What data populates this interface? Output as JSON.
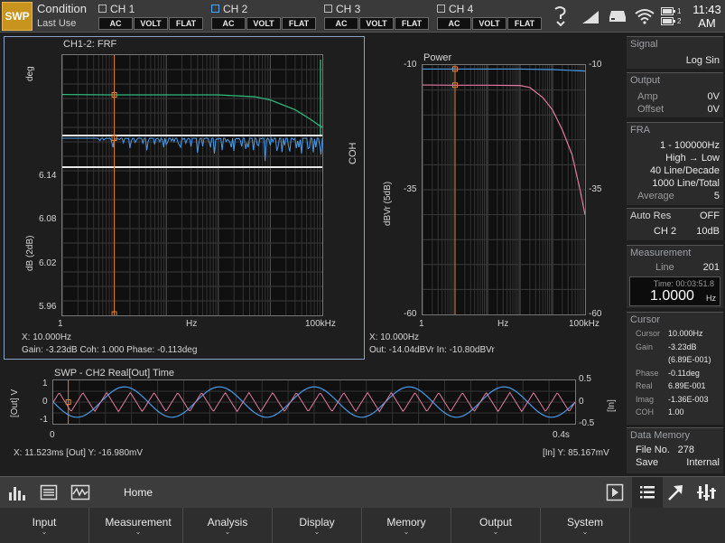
{
  "header": {
    "mode": "SWP",
    "condition_title": "Condition",
    "condition_value": "Last Use",
    "channels": [
      {
        "name": "CH 1",
        "buttons": [
          "AC",
          "VOLT",
          "FLAT"
        ],
        "selected": false
      },
      {
        "name": "CH 2",
        "buttons": [
          "AC",
          "VOLT",
          "FLAT"
        ],
        "selected": true
      },
      {
        "name": "CH 3",
        "buttons": [
          "AC",
          "VOLT",
          "FLAT"
        ],
        "selected": false
      },
      {
        "name": "CH 4",
        "buttons": [
          "AC",
          "VOLT",
          "FLAT"
        ],
        "selected": false
      }
    ],
    "battery_labels": [
      "1",
      "2"
    ],
    "time": "11:43",
    "ampm": "AM"
  },
  "frf": {
    "title": "CH1-2: FRF",
    "upper_ylabel": "deg",
    "lower_ylabel": "dB (2dB)",
    "right_label": "COH",
    "y_ticks": [
      "6.14",
      "6.08",
      "6.02",
      "5.96"
    ],
    "x_ticks": [
      "1",
      "Hz",
      "100kHz"
    ],
    "readout_x": "X: 10.000Hz",
    "readout_vals": "Gain: -3.23dB Coh: 1.000 Phase: -0.113deg"
  },
  "power": {
    "title": "Power",
    "ylabel": "dBVr (5dB)",
    "y_ticks_left": [
      "-10",
      "-35",
      "-60"
    ],
    "y_ticks_right": [
      "-10",
      "-35",
      "-60"
    ],
    "x_ticks": [
      "1",
      "Hz",
      "100kHz"
    ],
    "readout_x": "X: 10.000Hz",
    "readout_vals": "Out: -14.04dBVr In: -10.80dBVr"
  },
  "time_plot": {
    "title": "SWP - CH2 Real[Out] Time",
    "left_label": "[Out] V",
    "right_label": "[In]",
    "left_ticks": [
      "1",
      "0",
      "-1"
    ],
    "right_ticks": [
      "0.5",
      "0",
      "-0.5"
    ],
    "x_ticks": [
      "0",
      "0.4s"
    ],
    "readout_left": "X: 11.523ms [Out] Y: -16.980mV",
    "readout_right": "[In] Y: 85.167mV"
  },
  "chart_data": [
    {
      "type": "line",
      "title": "CH1-2: FRF",
      "xscale": "log",
      "xlim": [
        1,
        100000
      ],
      "ylim": [
        5.96,
        6.14
      ],
      "ylabel": "dB (2dB)",
      "cursor_x": 10,
      "series": [
        {
          "name": "Gain",
          "x": [
            1,
            10,
            100,
            1000,
            5000,
            10000,
            30000,
            60000,
            90000,
            100000
          ],
          "values": [
            -3.2,
            -3.23,
            -3.23,
            -3.23,
            -3.4,
            -3.7,
            -4.6,
            -5.5,
            -6.1,
            -6.2
          ]
        },
        {
          "name": "COH",
          "x": [
            1,
            10,
            100,
            1000,
            10000,
            100000
          ],
          "values": [
            1.0,
            1.0,
            1.0,
            1.0,
            1.0,
            1.0
          ]
        }
      ]
    },
    {
      "type": "line",
      "title": "Power",
      "xscale": "log",
      "xlim": [
        1,
        100000
      ],
      "ylim": [
        -60,
        -10
      ],
      "ylabel": "dBVr (5dB)",
      "cursor_x": 10,
      "series": [
        {
          "name": "In",
          "x": [
            1,
            10,
            100,
            1000,
            10000,
            100000
          ],
          "values": [
            -10.8,
            -10.8,
            -10.8,
            -10.8,
            -10.9,
            -11.2
          ]
        },
        {
          "name": "Out",
          "x": [
            1,
            10,
            100,
            1000,
            2000,
            5000,
            10000,
            20000,
            40000,
            70000,
            100000
          ],
          "values": [
            -14.0,
            -14.04,
            -14.04,
            -14.1,
            -14.5,
            -16.5,
            -19.0,
            -23.0,
            -28.0,
            -35.0,
            -40.0
          ]
        }
      ]
    },
    {
      "type": "line",
      "title": "SWP - CH2 Real[Out] Time",
      "xlim": [
        0,
        0.4
      ],
      "ylim": [
        -1,
        1
      ],
      "cursor_x": 0.011523,
      "series": [
        {
          "name": "[Out]",
          "amplitude": 0.7,
          "cycles": 5.5
        },
        {
          "name": "[In]",
          "amplitude": 0.22,
          "cycles": 22
        }
      ]
    }
  ],
  "sidebar": {
    "signal": {
      "title": "Signal",
      "value": "Log Sin"
    },
    "output": {
      "title": "Output",
      "amp_label": "Amp",
      "amp_value": "0V",
      "offset_label": "Offset",
      "offset_value": "0V"
    },
    "fra": {
      "title": "FRA",
      "range": "1 - 100000Hz",
      "direction": "High → Low",
      "density": "40 Line/Decade",
      "total": "1000 Line/Total",
      "avg_label": "Average",
      "avg_value": "5"
    },
    "autores": {
      "title": "Auto Res",
      "state": "OFF",
      "channel": "CH 2",
      "value": "10dB"
    },
    "measurement": {
      "title": "Measurement",
      "line_label": "Line",
      "line_value": "201",
      "time_label": "Time: 00:03:51.8",
      "freq_value": "1.0000",
      "freq_unit": "Hz"
    },
    "cursor": {
      "title": "Cursor",
      "rows": [
        {
          "label": "Cursor",
          "value": "10.000Hz"
        },
        {
          "label": "Gain",
          "value": "-3.23dB"
        },
        {
          "label": "",
          "value": "(6.89E-001)"
        },
        {
          "label": "Phase",
          "value": "-0.11deg"
        },
        {
          "label": "Real",
          "value": "6.89E-001"
        },
        {
          "label": "Imag",
          "value": "-1.36E-003"
        },
        {
          "label": "COH",
          "value": "1.00"
        }
      ]
    },
    "memory": {
      "title": "Data Memory",
      "file_label": "File No.",
      "file_value": "278",
      "save_label": "Save",
      "save_value": "Internal"
    }
  },
  "toolbar": {
    "home_label": "Home"
  },
  "menu": [
    "Input",
    "Measurement",
    "Analysis",
    "Display",
    "Memory",
    "Output",
    "System"
  ],
  "colors": {
    "gain": "#2fb87a",
    "coh": "#4a9ae8",
    "power_in": "#4a9ae8",
    "power_out": "#e07aa0",
    "cursor": "#e08030",
    "accent": "#c9941e"
  }
}
